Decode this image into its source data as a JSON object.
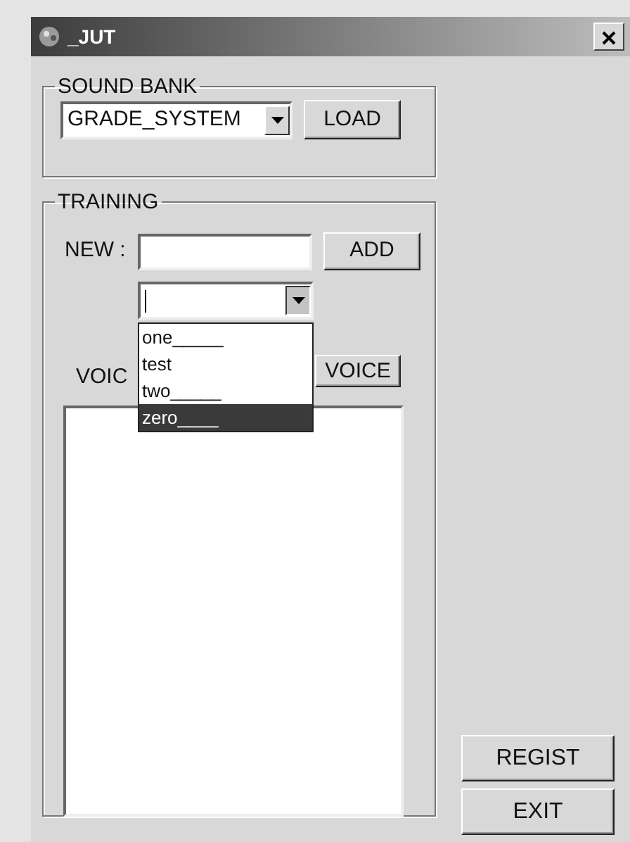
{
  "window": {
    "title": "_JUT"
  },
  "sound_bank": {
    "label": "SOUND BANK",
    "combo_value": "GRADE_SYSTEM",
    "load_button": "LOAD"
  },
  "training": {
    "label": "TRAINING",
    "new_label": "NEW :",
    "add_button": "ADD",
    "word_combo": {
      "expanded": true,
      "options": [
        {
          "label": "one_____",
          "selected": false
        },
        {
          "label": "test",
          "selected": false
        },
        {
          "label": "two_____",
          "selected": false
        },
        {
          "label": "zero____",
          "selected": true
        }
      ]
    },
    "voice_label": "VOIC",
    "voice_button": "VOICE"
  },
  "buttons": [
    "REGIST",
    "EXIT"
  ]
}
